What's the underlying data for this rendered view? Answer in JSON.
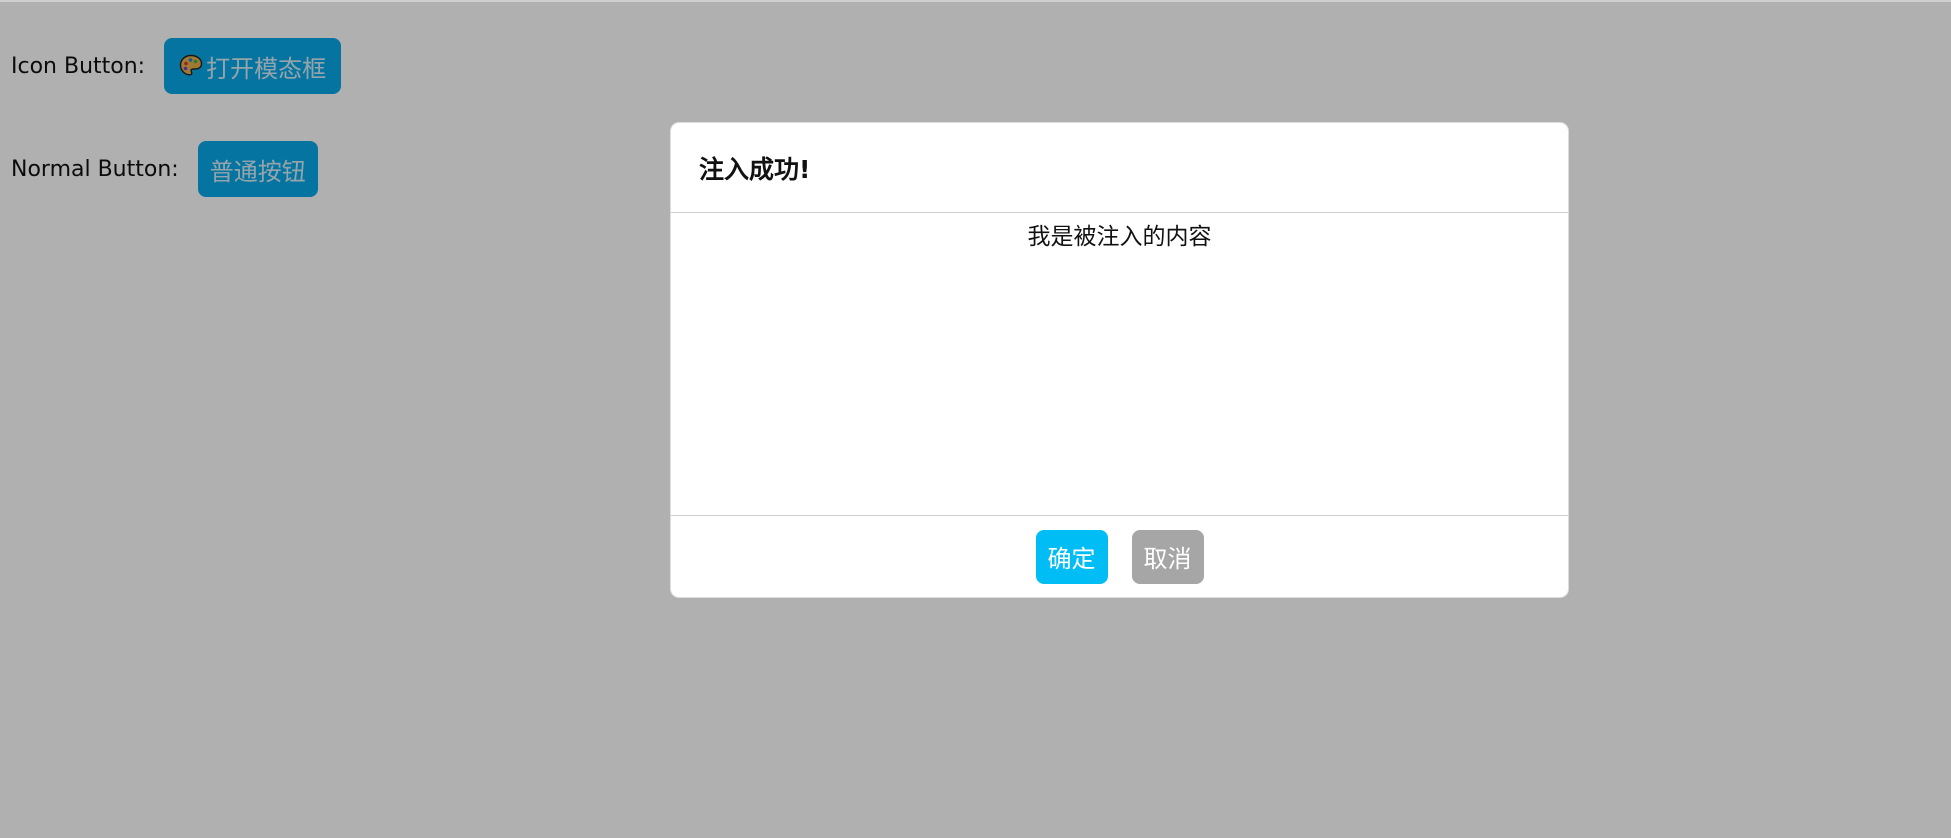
{
  "page": {
    "icon_button_row": {
      "label": "Icon Button:",
      "button": {
        "icon": "palette-icon",
        "label": "打开模态框"
      }
    },
    "normal_button_row": {
      "label": "Normal Button:",
      "button": {
        "label": "普通按钮"
      }
    }
  },
  "modal": {
    "title": "注入成功!",
    "body_text": "我是被注入的内容",
    "footer": {
      "confirm_label": "确定",
      "cancel_label": "取消"
    }
  },
  "colors": {
    "primary_button": "#0aa9e8",
    "confirm_button": "#00bef5",
    "cancel_button": "#a6a6a6"
  }
}
